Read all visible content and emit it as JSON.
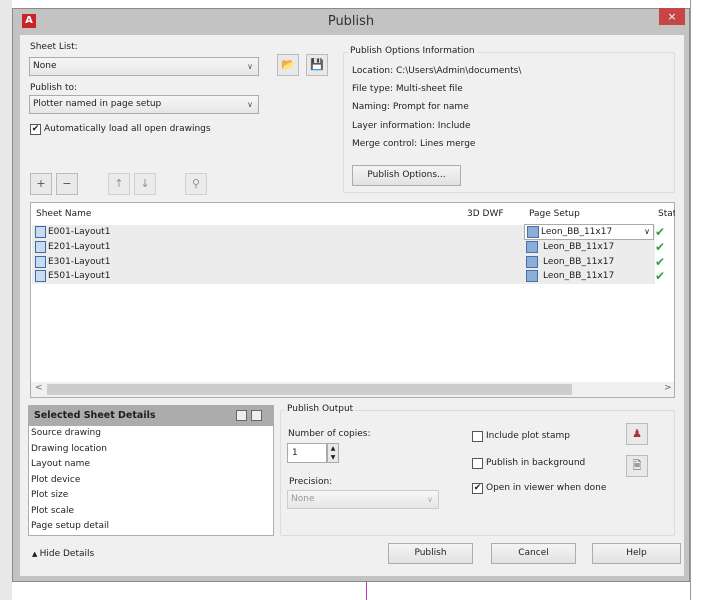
{
  "window": {
    "title": "Publish",
    "close": "×",
    "logo": "A"
  },
  "sheet_list": {
    "label": "Sheet List:",
    "value": "None"
  },
  "publish_to": {
    "label": "Publish to:",
    "value": "Plotter named in page setup"
  },
  "auto_load": {
    "label": "Automatically load all open drawings",
    "checked": true
  },
  "options_info": {
    "title": "Publish Options Information",
    "lines": [
      "Location: C:\\Users\\Admin\\documents\\",
      "File type: Multi-sheet file",
      "Naming: Prompt for name",
      "Layer information: Include",
      "Merge control: Lines merge"
    ],
    "button": "Publish Options..."
  },
  "list": {
    "columns": [
      "Sheet Name",
      "3D DWF",
      "Page Setup",
      "Stat"
    ],
    "rows": [
      {
        "name": "E001-Layout1",
        "setup": "Leon_BB_11x17"
      },
      {
        "name": "E201-Layout1",
        "setup": "Leon_BB_11x17"
      },
      {
        "name": "E301-Layout1",
        "setup": "Leon_BB_11x17"
      },
      {
        "name": "E501-Layout1",
        "setup": "Leon_BB_11x17"
      }
    ]
  },
  "details": {
    "title": "Selected Sheet Details",
    "items": [
      "Source drawing",
      "Drawing location",
      "Layout name",
      "Plot device",
      "Plot size",
      "Plot scale",
      "Page setup detail"
    ]
  },
  "output": {
    "title": "Publish Output",
    "copies_label": "Number of copies:",
    "copies": "1",
    "precision_label": "Precision:",
    "precision": "None",
    "plot_stamp": "Include plot stamp",
    "background": "Publish in background",
    "open_viewer": "Open in viewer when done"
  },
  "footer": {
    "hide": "Hide Details",
    "publish": "Publish",
    "cancel": "Cancel",
    "help": "Help"
  }
}
